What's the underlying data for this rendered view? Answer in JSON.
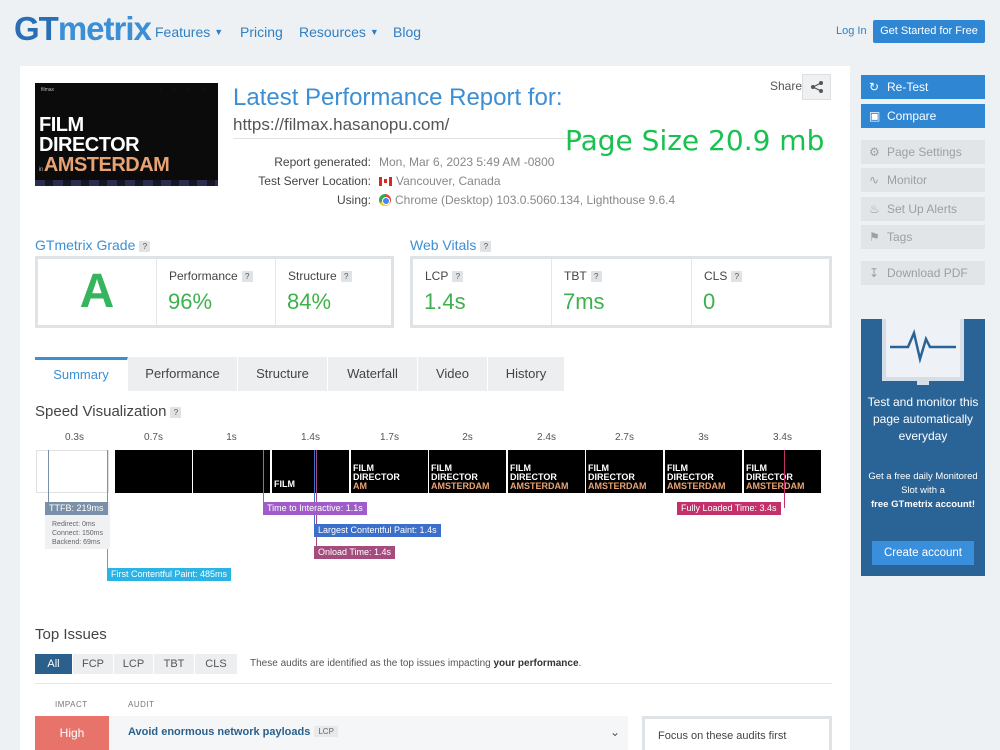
{
  "header": {
    "logo_gt": "GT",
    "logo_metrix": "metrix",
    "nav": [
      {
        "label": "Features",
        "dropdown": true
      },
      {
        "label": "Pricing",
        "dropdown": false
      },
      {
        "label": "Resources",
        "dropdown": true
      },
      {
        "label": "Blog",
        "dropdown": false
      }
    ],
    "login": "Log In",
    "cta": "Get Started for Free"
  },
  "report": {
    "thumbnail": {
      "logo": "filmax",
      "nav": "· · · ·",
      "line1": "FILM",
      "line2": "DIRECTOR",
      "line3_prefix": "in ",
      "line3": "AMSTERDAM"
    },
    "title": "Latest Performance Report for:",
    "url": "https://filmax.hasanopu.com/",
    "page_size": "Page Size 20.9 mb",
    "share": "Share",
    "meta": {
      "generated_label": "Report generated:",
      "generated_value": "Mon, Mar 6, 2023 5:49 AM -0800",
      "location_label": "Test Server Location:",
      "location_value": "Vancouver, Canada",
      "using_label": "Using:",
      "using_value": "Chrome (Desktop) 103.0.5060.134, Lighthouse 9.6.4"
    }
  },
  "grade": {
    "title": "GTmetrix Grade",
    "letter": "A",
    "performance_label": "Performance",
    "performance_value": "96%",
    "structure_label": "Structure",
    "structure_value": "84%"
  },
  "vitals": {
    "title": "Web Vitals",
    "lcp_label": "LCP",
    "lcp_value": "1.4s",
    "tbt_label": "TBT",
    "tbt_value": "7ms",
    "cls_label": "CLS",
    "cls_value": "0"
  },
  "tabs": [
    "Summary",
    "Performance",
    "Structure",
    "Waterfall",
    "Video",
    "History"
  ],
  "speed": {
    "title": "Speed Visualization",
    "frame_times": [
      "0.3s",
      "0.7s",
      "1s",
      "1.4s",
      "1.7s",
      "2s",
      "2.4s",
      "2.7s",
      "3s",
      "3.4s"
    ],
    "markers": {
      "ttfb": "TTFB: 219ms",
      "redirect": "Redirect: 0ms",
      "connect": "Connect: 150ms",
      "backend": "Backend: 69ms",
      "fcp": "First Contentful Paint: 485ms",
      "tti": "Time to Interactive: 1.1s",
      "lcp": "Largest Contentful Paint: 1.4s",
      "onload": "Onload Time: 1.4s",
      "fully_loaded": "Fully Loaded Time: 3.4s"
    },
    "colors": {
      "ttfb": "#7a8fa8",
      "fcp": "#2bb3e6",
      "tti": "#a05cc9",
      "lcp": "#3b6fc9",
      "onload": "#a54c7f",
      "fully": "#c2316a"
    }
  },
  "issues": {
    "title": "Top Issues",
    "filters": [
      "All",
      "FCP",
      "LCP",
      "TBT",
      "CLS"
    ],
    "note_prefix": "These audits are identified as the top issues impacting ",
    "note_bold": "your performance",
    "note_suffix": ".",
    "col_impact": "IMPACT",
    "col_audit": "AUDIT",
    "row": {
      "impact": "High",
      "audit": "Avoid enormous network payloads",
      "tag": "LCP"
    },
    "focus": "Focus on these audits first"
  },
  "sidebar": {
    "retest": "Re-Test",
    "compare": "Compare",
    "page_settings": "Page Settings",
    "monitor": "Monitor",
    "alerts": "Set Up Alerts",
    "tags": "Tags",
    "download": "Download PDF",
    "promo_heading": "Test and monitor this page automatically everyday",
    "promo_sub1": "Get a free daily Monitored Slot with a",
    "promo_sub_bold": "free GTmetrix account!",
    "promo_button": "Create account"
  }
}
